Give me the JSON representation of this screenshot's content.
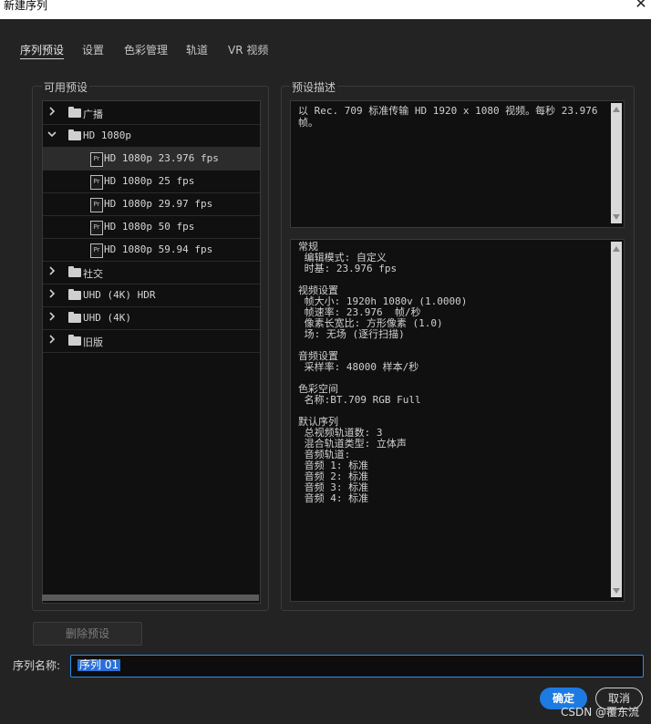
{
  "window": {
    "title": "新建序列",
    "close_glyph": "✕"
  },
  "tabs": [
    {
      "label": "序列预设",
      "active": true
    },
    {
      "label": "设置",
      "active": false
    },
    {
      "label": "色彩管理",
      "active": false
    },
    {
      "label": "轨道",
      "active": false
    },
    {
      "label": "VR 视频",
      "active": false
    }
  ],
  "presets_panel": {
    "title": "可用预设",
    "items": [
      {
        "label": "广播",
        "type": "folder",
        "expanded": false
      },
      {
        "label": "HD 1080p",
        "type": "folder",
        "expanded": true
      },
      {
        "label": "HD 1080p 23.976 fps",
        "type": "preset",
        "selected": true
      },
      {
        "label": "HD 1080p 25 fps",
        "type": "preset"
      },
      {
        "label": "HD 1080p 29.97 fps",
        "type": "preset"
      },
      {
        "label": "HD 1080p 50 fps",
        "type": "preset"
      },
      {
        "label": "HD 1080p 59.94 fps",
        "type": "preset"
      },
      {
        "label": "社交",
        "type": "folder",
        "expanded": false
      },
      {
        "label": "UHD (4K) HDR",
        "type": "folder",
        "expanded": false
      },
      {
        "label": "UHD (4K)",
        "type": "folder",
        "expanded": false
      },
      {
        "label": "旧版",
        "type": "folder",
        "expanded": false
      }
    ],
    "preset_icon_text": "Pr"
  },
  "description_panel": {
    "title": "预设描述",
    "description_lines": [
      "以 Rec. 709 标准传输 HD 1920 x 1080 视频。每秒 23.976",
      "帧。"
    ],
    "detail_lines": [
      "常规",
      " 编辑模式: 自定义",
      " 时基: 23.976 fps",
      "",
      "视频设置",
      " 帧大小: 1920h 1080v (1.0000)",
      " 帧速率: 23.976  帧/秒",
      " 像素长宽比: 方形像素 (1.0)",
      " 场: 无场 (逐行扫描)",
      "",
      "音频设置",
      " 采样率: 48000 样本/秒",
      "",
      "色彩空间",
      " 名称:BT.709 RGB Full",
      "",
      "默认序列",
      " 总视频轨道数: 3",
      " 混合轨道类型: 立体声",
      " 音频轨道:",
      " 音频 1: 标准",
      " 音频 2: 标准",
      " 音频 3: 标准",
      " 音频 4: 标准"
    ]
  },
  "buttons": {
    "delete_preset": "删除预设",
    "ok": "确定",
    "cancel": "取消"
  },
  "sequence_name": {
    "label": "序列名称:",
    "value": "序列 01"
  },
  "watermark": "CSDN @覆东流",
  "colors": {
    "accent": "#1d7ae0",
    "input_border": "#2d8ceb",
    "background": "#232323",
    "panel": "#101010"
  }
}
